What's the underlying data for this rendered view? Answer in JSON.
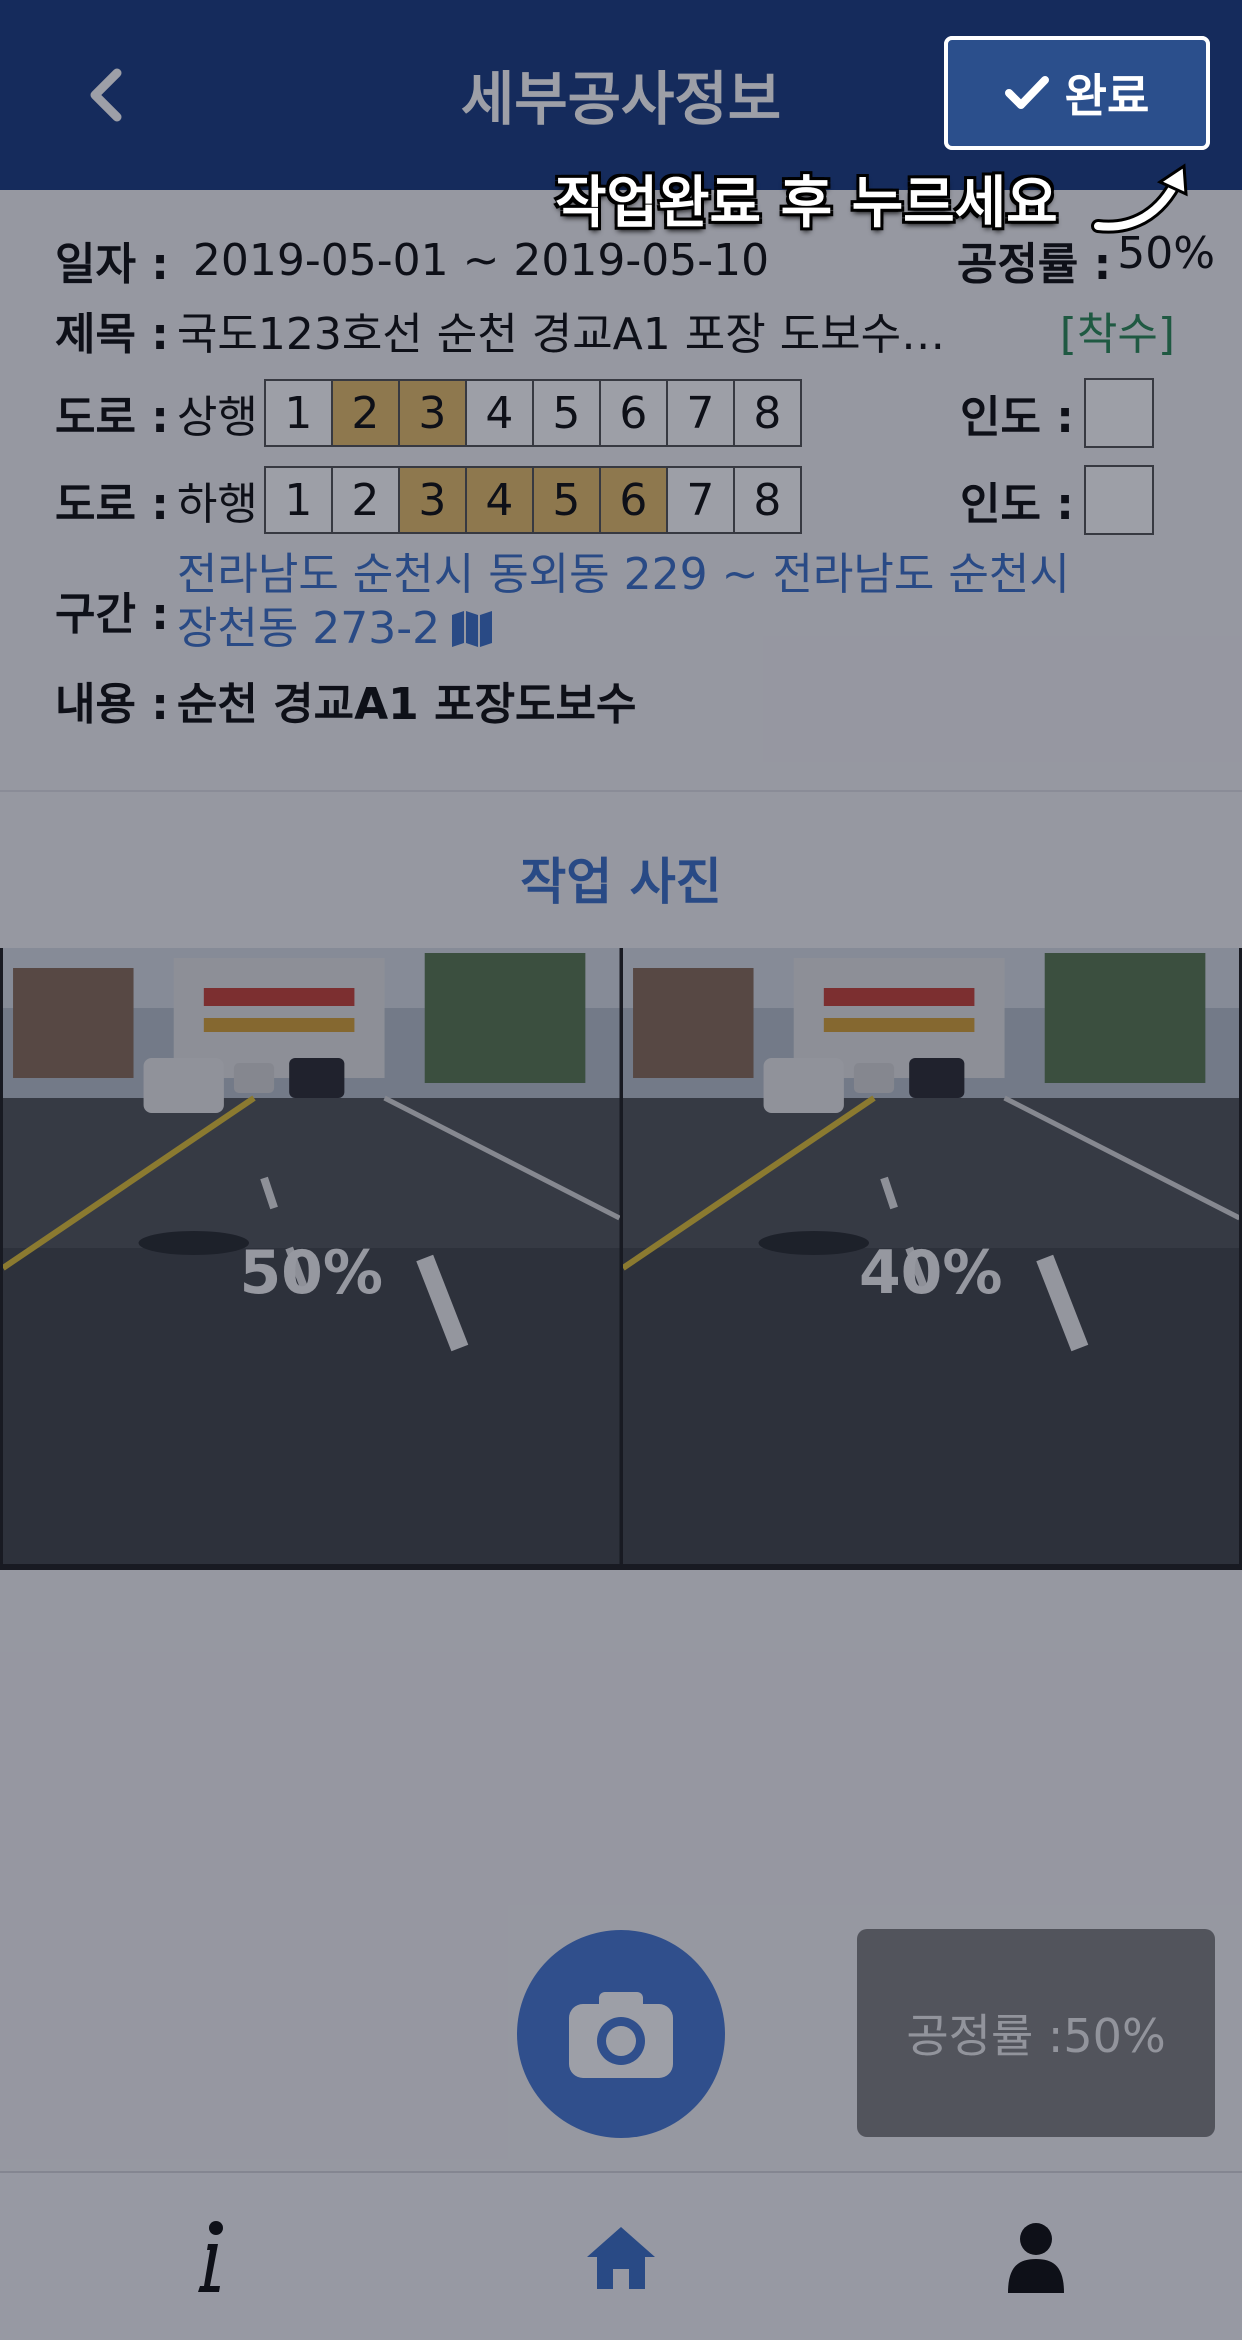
{
  "header": {
    "title": "세부공사정보",
    "done_label": "완료"
  },
  "info": {
    "date_label": "일자 :",
    "date_value": "2019-05-01 ~ 2019-05-10",
    "rate_label": "공정률 :",
    "rate_value": "50%",
    "title_label": "제목 :",
    "title_value": "국도123호선 순천 경교A1 포장 도보수…",
    "status": "[착수]",
    "road_label": "도로 :",
    "up_label": "상행",
    "down_label": "하행",
    "lanes": [
      "1",
      "2",
      "3",
      "4",
      "5",
      "6",
      "7",
      "8"
    ],
    "up_selected": [
      2,
      3
    ],
    "down_selected": [
      3,
      4,
      5,
      6
    ],
    "sidewalk_label": "인도 :",
    "section_label": "구간 :",
    "section_line1": "전라남도 순천시 동외동 229 ~ 전라남도 순천시",
    "section_line2": "장천동 273-2",
    "content_label": "내용 :",
    "content_value": "순천 경교A1 포장도보수"
  },
  "photos": {
    "title": "작업 사진",
    "items": [
      {
        "percent": "50%"
      },
      {
        "percent": "40%"
      }
    ]
  },
  "progress_box": "공정률 :50%",
  "tabs": {
    "info": "info-icon",
    "home": "home-icon",
    "user": "user-icon"
  },
  "coach": {
    "hint": "작업완료 후 누르세요"
  },
  "colors": {
    "header": "#1d3f82",
    "accent": "#3f72c6",
    "selected_lane": "#e6bf6c",
    "status": "#2e8b57"
  }
}
